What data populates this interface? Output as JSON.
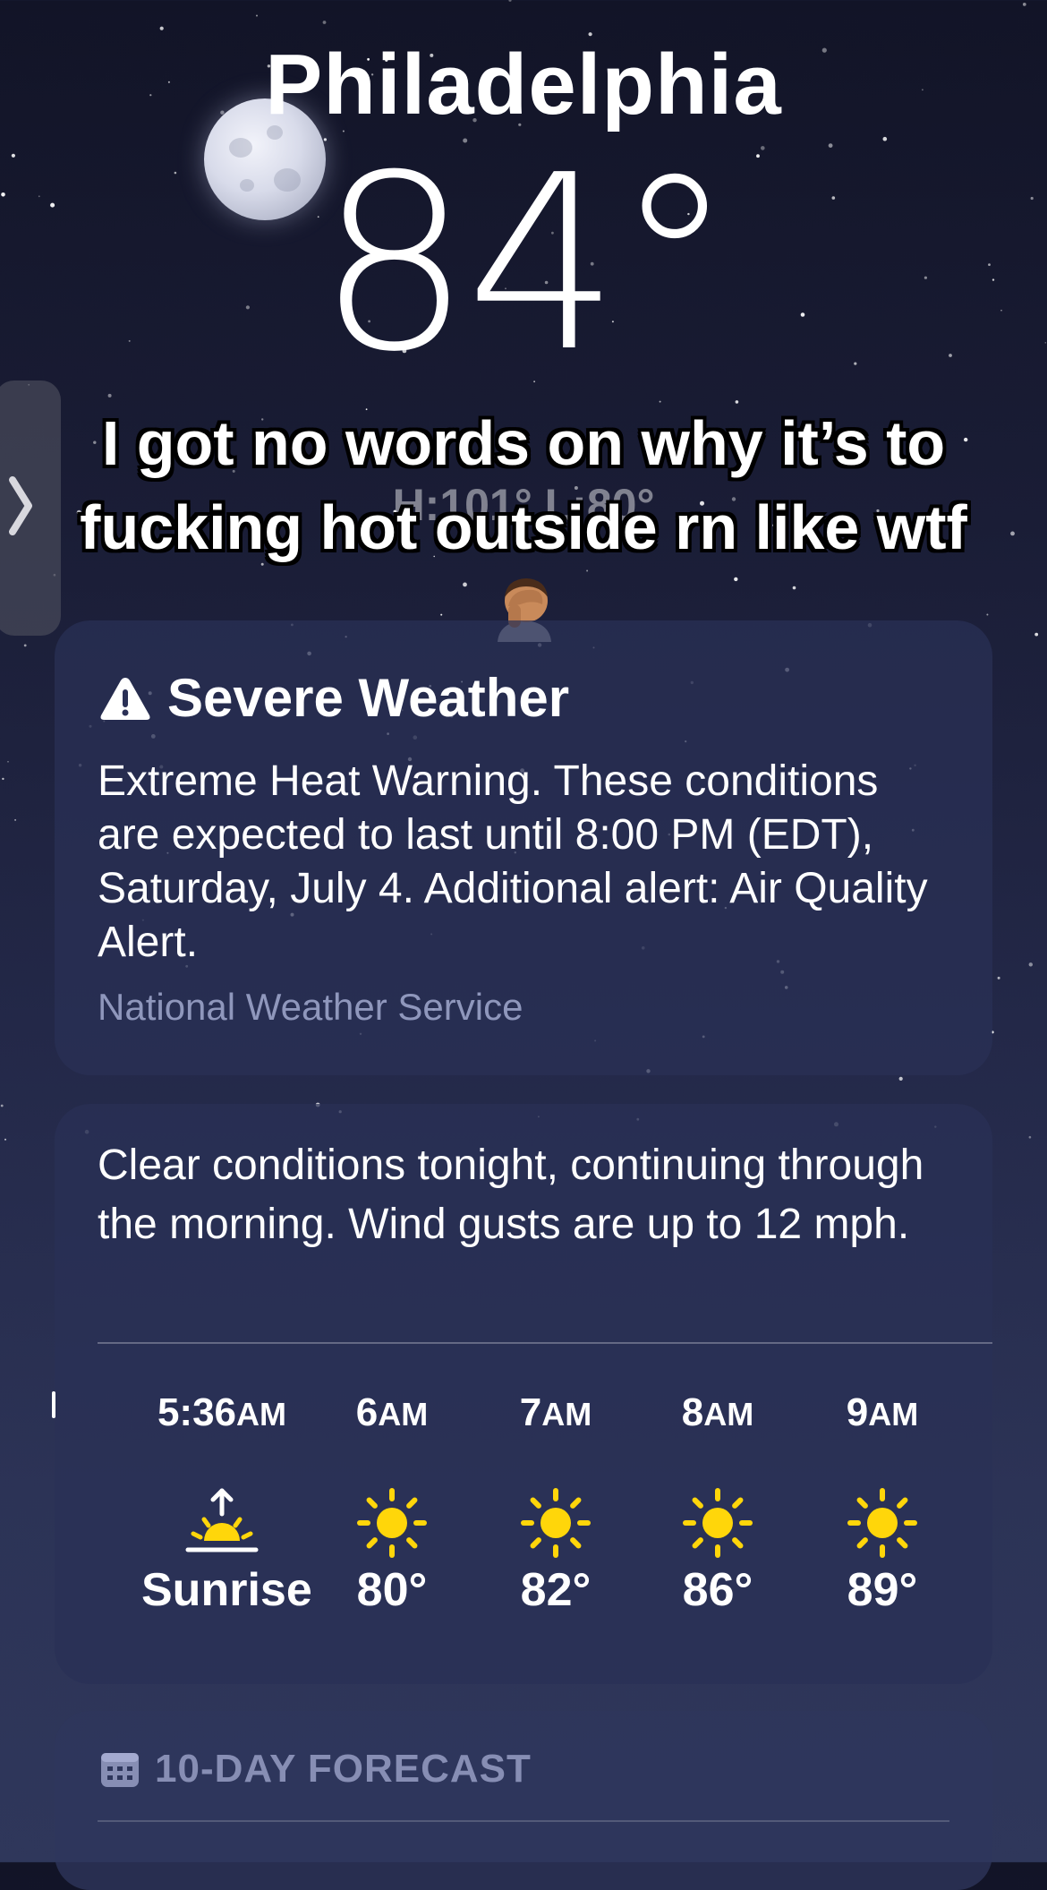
{
  "location": {
    "city": "Philadelphia",
    "temperature": "84°",
    "hi_lo": "H:101°  L:80°"
  },
  "caption": {
    "text": "I got no words on why it’s to fucking hot outside rn like wtf",
    "emoji": "facepalm-person"
  },
  "alert": {
    "icon": "warning-triangle-icon",
    "title": "Severe Weather",
    "body": "Extreme Heat Warning. These conditions are expected to last until 8:00 PM (EDT), Saturday, July 4. Additional alert: Air Quality Alert.",
    "source": "National Weather Service"
  },
  "hourly": {
    "summary": "Clear conditions tonight, continuing through the morning. Wind gusts are up to 12 mph.",
    "hours": [
      {
        "time": "5:36",
        "period": "AM",
        "icon": "sunrise-icon",
        "value": "Sunrise"
      },
      {
        "time": "6",
        "period": "AM",
        "icon": "sun-icon",
        "value": "80°"
      },
      {
        "time": "7",
        "period": "AM",
        "icon": "sun-icon",
        "value": "82°"
      },
      {
        "time": "8",
        "period": "AM",
        "icon": "sun-icon",
        "value": "86°"
      },
      {
        "time": "9",
        "period": "AM",
        "icon": "sun-icon",
        "value": "89°"
      }
    ]
  },
  "forecast": {
    "icon": "calendar-icon",
    "title": "10-DAY FORECAST"
  },
  "colors": {
    "sun": "#FFD60A",
    "background_top": "#121427",
    "background_bottom": "#2f375b"
  }
}
